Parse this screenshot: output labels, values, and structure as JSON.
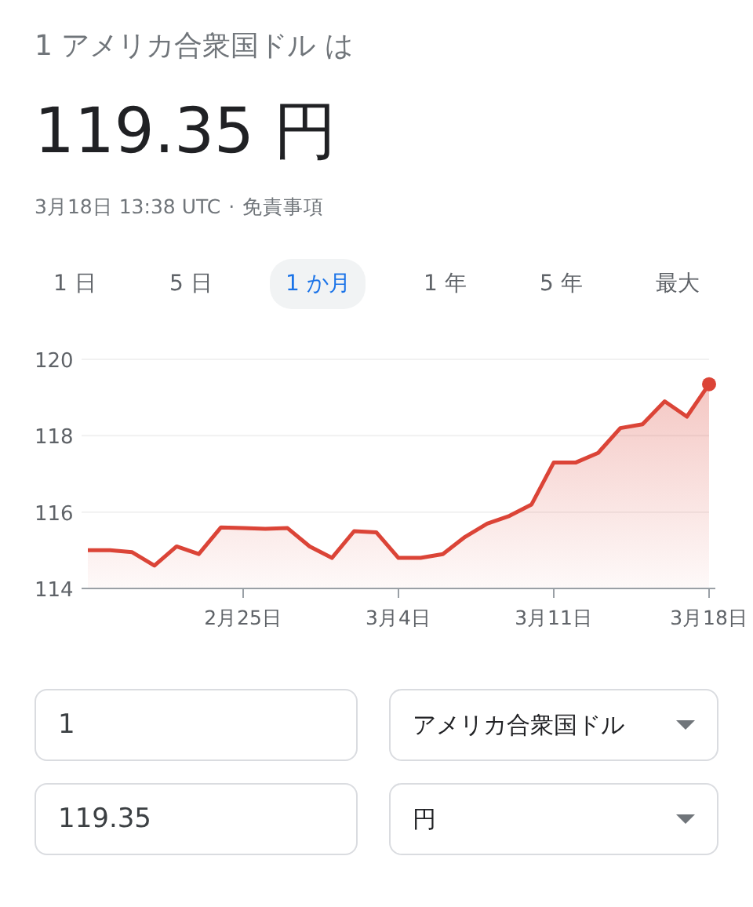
{
  "header": {
    "query": "1 アメリカ合衆国ドル は",
    "result": "119.35 円",
    "timestamp": "3月18日 13:38 UTC",
    "separator": "·",
    "disclaimer": "免責事項"
  },
  "tabs": [
    {
      "label": "1 日",
      "selected": false
    },
    {
      "label": "5 日",
      "selected": false
    },
    {
      "label": "1 か月",
      "selected": true
    },
    {
      "label": "1 年",
      "selected": false
    },
    {
      "label": "5 年",
      "selected": false
    },
    {
      "label": "最大",
      "selected": false
    }
  ],
  "chart": {
    "chart_data": {
      "type": "area",
      "categories": [
        null,
        null,
        null,
        null,
        null,
        null,
        null,
        "2月25日",
        null,
        null,
        null,
        null,
        null,
        null,
        "3月4日",
        null,
        null,
        null,
        null,
        null,
        null,
        "3月11日",
        null,
        null,
        null,
        null,
        null,
        null,
        "3月18日"
      ],
      "series": [
        {
          "color": "#db4437",
          "values": [
            115.0,
            115.0,
            114.95,
            114.6,
            115.1,
            114.9,
            115.6,
            115.58,
            115.56,
            115.58,
            115.1,
            114.8,
            115.5,
            115.47,
            114.8,
            114.8,
            114.9,
            115.35,
            115.7,
            115.9,
            116.2,
            117.3,
            117.3,
            117.55,
            118.2,
            118.3,
            118.9,
            118.5,
            119.35
          ]
        }
      ],
      "ylim": [
        114,
        120
      ],
      "yticks": [
        114,
        116,
        118,
        120
      ]
    }
  },
  "converter": [
    {
      "amount": "1",
      "currency": "アメリカ合衆国ドル"
    },
    {
      "amount": "119.35",
      "currency": "円"
    }
  ]
}
